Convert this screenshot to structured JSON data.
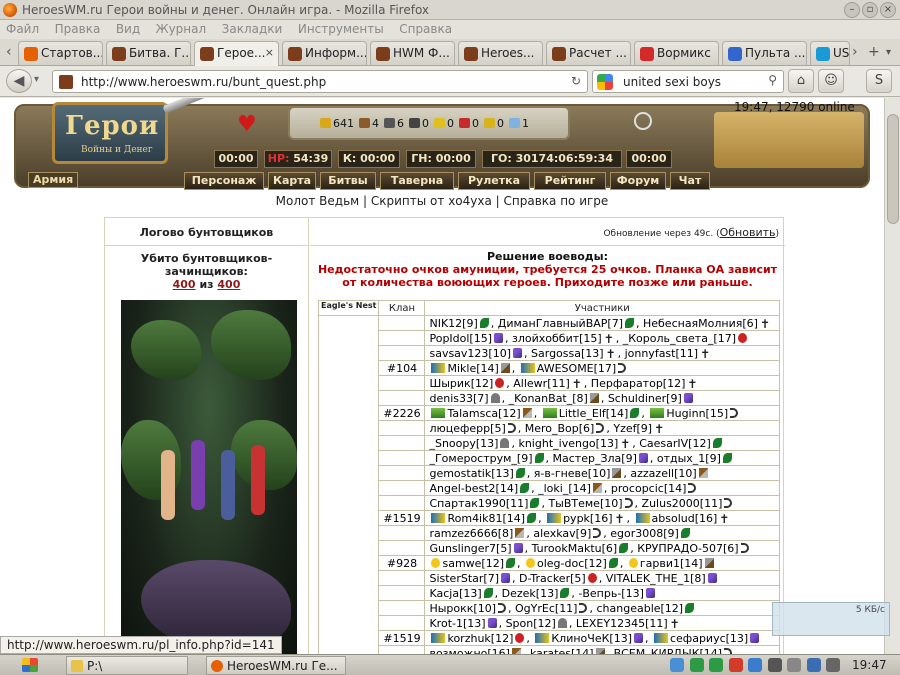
{
  "window": {
    "title": "HeroesWM.ru Герои войны и денег. Онлайн игра. - Mozilla Firefox"
  },
  "menu": [
    "Файл",
    "Правка",
    "Вид",
    "Журнал",
    "Закладки",
    "Инструменты",
    "Справка"
  ],
  "tabs": [
    {
      "label": "Стартов...",
      "icon_color": "#e66000"
    },
    {
      "label": "Битва. Г...",
      "icon_color": "#7b3d1b"
    },
    {
      "label": "Герое...",
      "icon_color": "#7b3d1b",
      "active": true
    },
    {
      "label": "Информ...",
      "icon_color": "#7b3d1b"
    },
    {
      "label": "HWM Ф...",
      "icon_color": "#7b3d1b"
    },
    {
      "label": "Heroes...",
      "icon_color": "#7b3d1b"
    },
    {
      "label": "Расчет ...",
      "icon_color": "#7b3d1b"
    },
    {
      "label": "Вормикс",
      "icon_color": "#d42a2a"
    },
    {
      "label": "Пульта ...",
      "icon_color": "#3366cc"
    },
    {
      "label": "US",
      "icon_color": "#1a9bd7"
    }
  ],
  "tab_close_glyph": "×",
  "toolbar": {
    "url": "http://www.heroeswm.ru/bunt_quest.php",
    "search_text": "united sexi boys"
  },
  "game": {
    "logo_text": "Герои",
    "logo_sub": "Войны и Денег",
    "online_status": "19:47, 12790 online",
    "resources": [
      {
        "value": "641",
        "color": "#d9a818"
      },
      {
        "value": "4",
        "color": "#8b5a2b"
      },
      {
        "value": "6",
        "color": "#555555"
      },
      {
        "value": "0",
        "color": "#444444"
      },
      {
        "value": "0",
        "color": "#e0c020"
      },
      {
        "value": "0",
        "color": "#c62a2a"
      },
      {
        "value": "0",
        "color": "#d7b31c"
      },
      {
        "value": "1",
        "color": "#7fb2e0"
      }
    ],
    "timers": {
      "t1": "00:00",
      "hp_label": "HP:",
      "hp_value": " 54:39",
      "k": "К: 00:00",
      "gn": "ГН: 00:00",
      "go": "ГО: 30174:06:59:34",
      "t6": "00:00"
    },
    "army_label": "Армия",
    "nav": [
      "Персонаж",
      "Карта",
      "Битвы",
      "Таверна",
      "Рулетка",
      "Рейтинг",
      "Форум",
      "Чат"
    ],
    "sublinks": "Молот Ведьм | Скрипты от хо4уха | Справка по игре"
  },
  "quest": {
    "left_title": "Логово бунтовщиков",
    "kills_label": "Убито бунтовщиков-зачинщиков:",
    "kills_value": "400",
    "kills_of": "из",
    "kills_total": "400",
    "update_text": "Обновление через 49с.",
    "update_link": "Обновить",
    "decision_title": "Решение воеводы:",
    "decision_text": "Недостаточно очков амуниции, требуется 25 очков. Планка ОА зависит от количества воюющих героев. Приходите позже или раньше.",
    "nest_label": "Eagle's Nest",
    "col_clan": "Клан",
    "col_participants": "Участники"
  },
  "rows": [
    {
      "clan": "",
      "p": [
        [
          "NIK12[9]",
          "leaf"
        ],
        [
          "ДиманГлавныйВАР[7]",
          "leaf"
        ],
        [
          "НебеснаяМолния[6]",
          "cross"
        ]
      ]
    },
    {
      "clan": "",
      "p": [
        [
          "PopIdol[15]",
          "wand"
        ],
        [
          "злойхоббит[15]",
          "cross"
        ],
        [
          "_Король_света_[17]",
          "skull"
        ]
      ]
    },
    {
      "clan": "",
      "p": [
        [
          "savsav123[10]",
          "wand"
        ],
        [
          "Sargossa[13]",
          "cross"
        ],
        [
          "jonnyfast[11]",
          "cross"
        ]
      ]
    },
    {
      "clan": "#104",
      "p": [
        [
          "Mikle[14]",
          "dagger",
          "badge"
        ],
        [
          "AWESOME[17]",
          "hook",
          "badge"
        ]
      ]
    },
    {
      "clan": "",
      "p": [
        [
          "Шырик[12]",
          "skull"
        ],
        [
          "Allewr[11]",
          "cross"
        ],
        [
          "Перфаратор[12]",
          "cross"
        ]
      ]
    },
    {
      "clan": "",
      "p": [
        [
          "denis33[7]",
          "helm"
        ],
        [
          "_KonanBat_[8]",
          "dagger"
        ],
        [
          "Schuldiner[9]",
          "wand"
        ]
      ]
    },
    {
      "clan": "#2226",
      "p": [
        [
          "Talamsca[12]",
          "axe",
          "tgbadge"
        ],
        [
          "Little_Elf[14]",
          "leaf",
          "tgbadge"
        ],
        [
          "Huginn[15]",
          "hook",
          "tgbadge"
        ]
      ]
    },
    {
      "clan": "",
      "p": [
        [
          "люцеферр[5]",
          "hook"
        ],
        [
          "Mero_Bop[6]",
          "hook"
        ],
        [
          "Yzef[9]",
          "cross"
        ]
      ]
    },
    {
      "clan": "",
      "p": [
        [
          "_Snoopy[13]",
          "helm"
        ],
        [
          "knight_ivengo[13]",
          "cross"
        ],
        [
          "CaesarIV[12]",
          "leaf"
        ]
      ]
    },
    {
      "clan": "",
      "p": [
        [
          "_Гомерострум_[9]",
          "leaf"
        ],
        [
          "Мастер_Зла[9]",
          "wand"
        ],
        [
          "отдых_1[9]",
          "leaf"
        ]
      ]
    },
    {
      "clan": "",
      "p": [
        [
          "gemostatik[13]",
          "leaf"
        ],
        [
          "я-в-гневе[10]",
          "dagger"
        ],
        [
          "azzazell[10]",
          "axe"
        ]
      ]
    },
    {
      "clan": "",
      "p": [
        [
          "Angel-best2[14]",
          "leaf"
        ],
        [
          "_loki_[14]",
          "axe"
        ],
        [
          "procopcic[14]",
          "hook"
        ]
      ]
    },
    {
      "clan": "",
      "p": [
        [
          "Спартак1990[11]",
          "leaf"
        ],
        [
          "ТыВТеме[10]",
          "hook"
        ],
        [
          "Zulus2000[11]",
          "hook"
        ]
      ]
    },
    {
      "clan": "#1519",
      "p": [
        [
          "Rom4ik81[14]",
          "leaf",
          "badge"
        ],
        [
          "pypk[16]",
          "cross",
          "badge"
        ],
        [
          "absolud[16]",
          "cross",
          "badge"
        ]
      ]
    },
    {
      "clan": "",
      "p": [
        [
          "ramzez6666[8]",
          "axe"
        ],
        [
          "alexkav[9]",
          "hook"
        ],
        [
          "egor3008[9]",
          "leaf"
        ]
      ]
    },
    {
      "clan": "",
      "p": [
        [
          "Gunslinger7[5]",
          "wand"
        ],
        [
          "TurookMaktu[6]",
          "leaf"
        ],
        [
          "КРУПРАДО-507[6]",
          "hook"
        ]
      ]
    },
    {
      "clan": "#928",
      "p": [
        [
          "samwe[12]",
          "leaf",
          "smile"
        ],
        [
          "oleg-doc[12]",
          "leaf",
          "smile"
        ],
        [
          "гарви1[14]",
          "dagger",
          "smile"
        ]
      ]
    },
    {
      "clan": "",
      "p": [
        [
          "SisterStar[7]",
          "wand"
        ],
        [
          "D-Tracker[5]",
          "skull"
        ],
        [
          "VITALEK_THE_1[8]",
          "wand"
        ]
      ]
    },
    {
      "clan": "",
      "p": [
        [
          "Kacja[13]",
          "leaf"
        ],
        [
          "Dezek[13]",
          "leaf"
        ],
        [
          "-Вепрь-[13]",
          "wand"
        ]
      ]
    },
    {
      "clan": "",
      "p": [
        [
          "Нырокк[10]",
          "hook"
        ],
        [
          "OgYrEc[11]",
          "hook"
        ],
        [
          "changeable[12]",
          "leaf"
        ]
      ]
    },
    {
      "clan": "",
      "p": [
        [
          "Krot-1[13]",
          "wand"
        ],
        [
          "Spon[12]",
          "helm"
        ],
        [
          "LEXEY12345[11]",
          "cross"
        ]
      ]
    },
    {
      "clan": "#1519",
      "p": [
        [
          "korzhuk[12]",
          "skull",
          "badge"
        ],
        [
          "КлиноЧеК[13]",
          "wand",
          "badge"
        ],
        [
          "сефариус[13]",
          "wand",
          "badge"
        ]
      ]
    },
    {
      "clan": "",
      "p": [
        [
          "возможно[16]",
          "axe"
        ],
        [
          "karates[14]",
          "dagger"
        ],
        [
          "ВСЕМ_КИРДЫК[14]",
          "hook"
        ]
      ]
    }
  ],
  "status_url": "http://www.heroeswm.ru/pl_info.php?id=141",
  "download_speed": "5 КБ/с",
  "taskbar": {
    "task1": "P:\\",
    "task2": "HeroesWM.ru Ге...",
    "clock": "19:47"
  }
}
